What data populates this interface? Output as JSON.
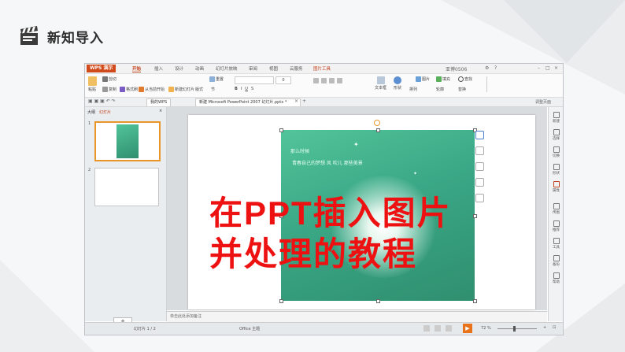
{
  "slide": {
    "title": "新知导入",
    "icon": "clapperboard-icon"
  },
  "wps": {
    "app_name": "WPS 演示",
    "menu_tabs": [
      "开始",
      "插入",
      "设计",
      "动画",
      "幻灯片放映",
      "审阅",
      "视图",
      "云服务",
      "图片工具"
    ],
    "active_tab": "开始",
    "user_name": "亚博0506",
    "ribbon": {
      "paste": "粘贴",
      "cut": "剪切",
      "copy": "复制",
      "format_painter": "格式刷",
      "from_current": "从当前开始",
      "new_slide": "新建幻灯片",
      "layout": "版式",
      "reset": "重置",
      "section": "节",
      "font_size": "0",
      "textbox": "文本框",
      "shape": "形状",
      "arrange": "排列",
      "picture": "图片",
      "fill": "填充",
      "outline": "轮廓",
      "find": "查找",
      "replace": "替换"
    },
    "doc_tabs": {
      "my_wps": "我的WPS",
      "file": "新建 Microsoft PowerPoint 2007 幻灯片.pptx *"
    },
    "panel_tabs": {
      "outline": "大纲",
      "slides": "幻灯片"
    },
    "thumb_numbers": [
      "1",
      "2"
    ],
    "poem_lines": [
      "那么时候",
      "青春自己的梦想    风    吹儿  那些美景"
    ],
    "notes_placeholder": "单击此处添加备注",
    "status": {
      "slide_count": "幻灯片 1 / 2",
      "theme": "Office 主题",
      "zoom": "72 %"
    },
    "sidebar_items": [
      "新建",
      "选择",
      "切换",
      "形状",
      "属性",
      "传图",
      "推荐",
      "工具",
      "备份",
      "帮助"
    ],
    "top_right_label": "调整页面"
  },
  "overlay": {
    "line1": "在PPT插入图片",
    "line2": "并处理的教程"
  },
  "colors": {
    "wps_accent": "#d14a1b",
    "overlay_red": "#ee1111",
    "image_green": "#3aa785"
  }
}
